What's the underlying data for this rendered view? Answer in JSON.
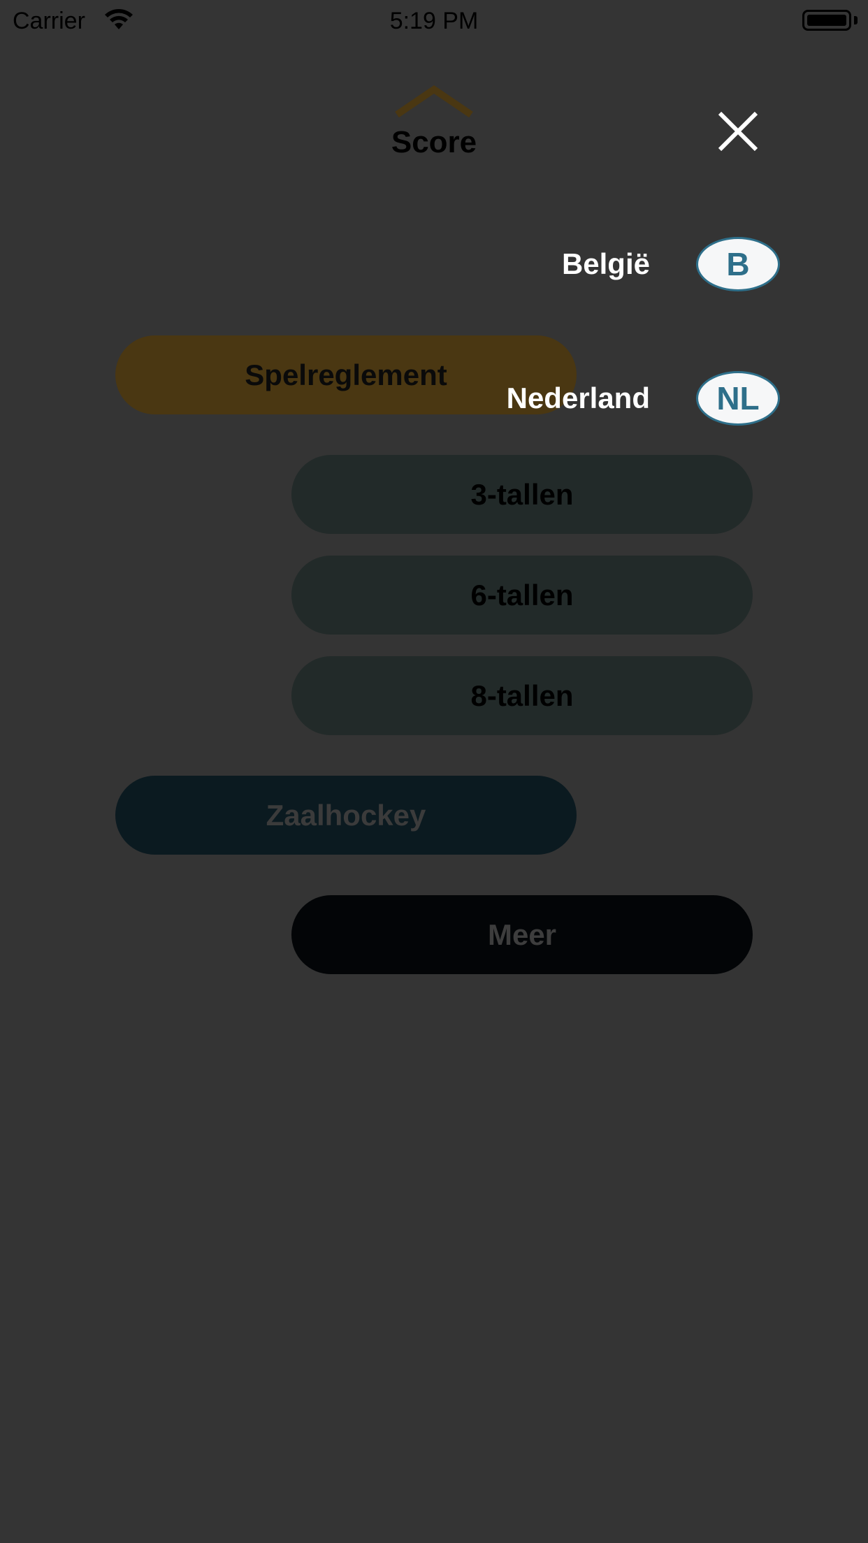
{
  "status_bar": {
    "carrier": "Carrier",
    "time": "5:19 PM"
  },
  "header": {
    "logo_text": "Score",
    "close_icon": "close-icon"
  },
  "menu": {
    "spelreglement": "Spelreglement",
    "sub_items": [
      "3-tallen",
      "6-tallen",
      "8-tallen"
    ],
    "zaalhockey": "Zaalhockey",
    "meer": "Meer"
  },
  "language_picker": {
    "options": [
      {
        "label": "België",
        "badge": "B"
      },
      {
        "label": "Nederland",
        "badge": "NL"
      }
    ]
  },
  "colors": {
    "overlay": "#343434",
    "badge_accent": "#2e6f8a",
    "logo_accent": "#4a3712"
  }
}
